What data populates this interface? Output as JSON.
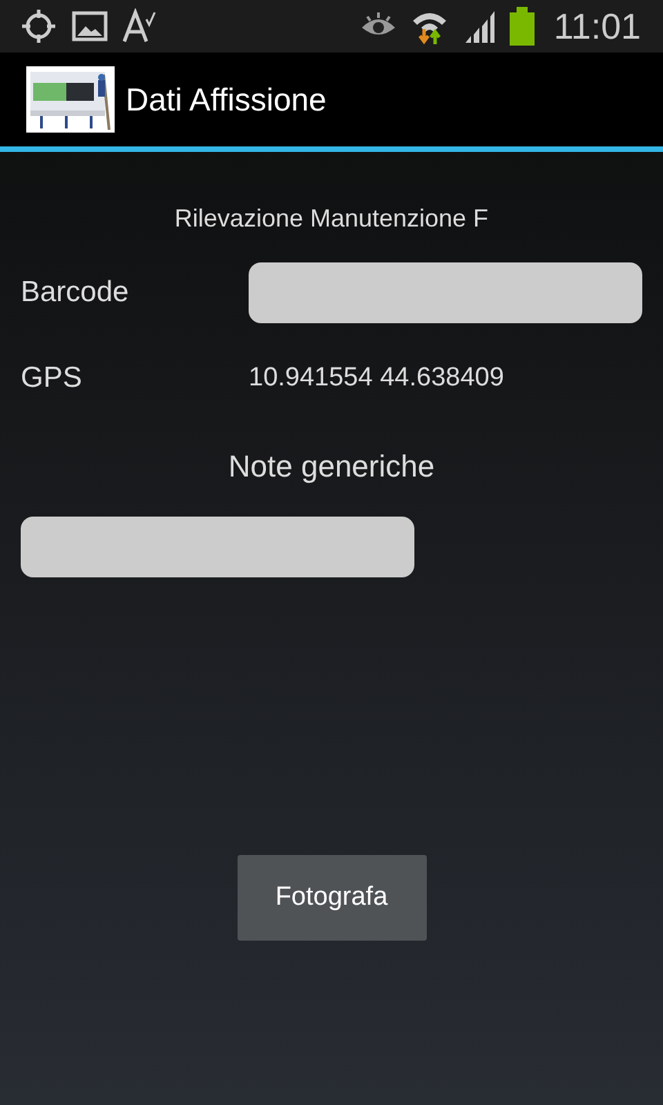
{
  "status_bar": {
    "time": "11:01"
  },
  "action_bar": {
    "title": "Dati Affissione"
  },
  "form": {
    "heading": "Rilevazione Manutenzione F",
    "barcode": {
      "label": "Barcode"
    },
    "gps": {
      "label": "GPS",
      "value": "10.941554  44.638409"
    },
    "notes": {
      "label": "Note generiche"
    }
  },
  "buttons": [
    "Fotografa"
  ]
}
